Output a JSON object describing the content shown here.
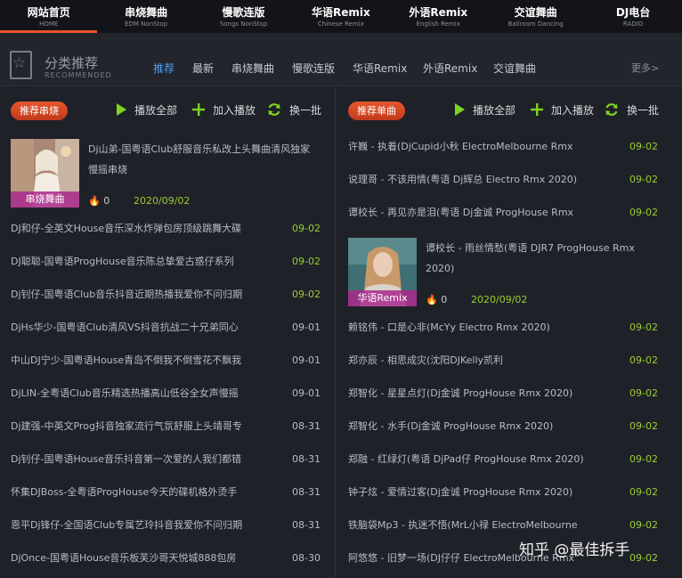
{
  "top_nav": [
    {
      "zh": "网站首页",
      "en": "HOME"
    },
    {
      "zh": "串烧舞曲",
      "en": "EDM NonStop"
    },
    {
      "zh": "慢歌连版",
      "en": "Songs NonStop"
    },
    {
      "zh": "华语Remix",
      "en": "Chinese Remix"
    },
    {
      "zh": "外语Remix",
      "en": "English Remix"
    },
    {
      "zh": "交谊舞曲",
      "en": "Ballroom Dancing"
    },
    {
      "zh": "DJ电台",
      "en": "RADIO"
    }
  ],
  "section": {
    "title": "分类推荐",
    "subtitle": "RECOMMENDED",
    "more": "更多>"
  },
  "tabs": [
    "推荐",
    "最新",
    "串烧舞曲",
    "慢歌连版",
    "华语Remix",
    "外语Remix",
    "交谊舞曲"
  ],
  "left": {
    "badge": "推荐串烧",
    "play_all": "播放全部",
    "add_play": "加入播放",
    "refresh": "换一批",
    "feature": {
      "cover_label": "串烧舞曲",
      "title": "Dj山弟-国粤语Club舒服音乐私改上头舞曲清风独家慢摇串烧",
      "plays": "0",
      "date": "2020/09/02"
    },
    "rows": [
      {
        "title": "DJ和仔-全英文House音乐深水炸弹包房顶级跳舞大碟",
        "date": "09-02",
        "recent": true
      },
      {
        "title": "DJ聪聪-国粤语ProgHouse音乐陈总挚爱古惑仔系列",
        "date": "09-02",
        "recent": true
      },
      {
        "title": "Dj钊仔-国粤语Club音乐抖音近期热播我爱你不问归期",
        "date": "09-02",
        "recent": true
      },
      {
        "title": "DjHs华少-国粤语Club清风VS抖音抗战二十兄弟同心",
        "date": "09-01",
        "recent": false
      },
      {
        "title": "中山DJ宁少-国粤语House青岛不倒我不倒雪花不飘我",
        "date": "09-01",
        "recent": false
      },
      {
        "title": "DjLIN-全粤语Club音乐精选热播高山低谷全女声慢摇",
        "date": "09-01",
        "recent": false
      },
      {
        "title": "Dj建强-中英文Prog抖音独家流行气氛舒服上头靖哥专",
        "date": "08-31",
        "recent": false
      },
      {
        "title": "Dj钊仔-国粤语House音乐抖音第一次爱的人我们都错",
        "date": "08-31",
        "recent": false
      },
      {
        "title": "怀集DJBoss-全粤语ProgHouse今天的碟机格外烫手",
        "date": "08-31",
        "recent": false
      },
      {
        "title": "恩平Dj锋仔-全国语Club专属艺玲抖音我爱你不问归期",
        "date": "08-31",
        "recent": false
      },
      {
        "title": "DjOnce-国粤语House音乐板芙沙哥天悦城888包房",
        "date": "08-30",
        "recent": false
      }
    ]
  },
  "right": {
    "badge": "推荐单曲",
    "play_all": "播放全部",
    "add_play": "加入播放",
    "refresh": "换一批",
    "rows_top": [
      {
        "title": "许巍 - 执着(DjCupid小秋 ElectroMelbourne Rmx",
        "date": "09-02"
      },
      {
        "title": "说理哥 - 不该用情(粤语 Dj辉总 Electro Rmx 2020)",
        "date": "09-02"
      },
      {
        "title": "谭校长 - 再见亦是泪(粤语 Dj金诚 ProgHouse Rmx",
        "date": "09-02"
      }
    ],
    "feature": {
      "cover_label": "华语Remix",
      "title": "谭校长 - 雨丝情愁(粤语 DJR7 ProgHouse Rmx 2020)",
      "plays": "0",
      "date": "2020/09/02"
    },
    "rows": [
      {
        "title": "赖铭伟 - 口是心非(McYy Electro Rmx 2020)",
        "date": "09-02"
      },
      {
        "title": "郑亦辰 - 相思成灾(沈阳DJKelly凯利",
        "date": "09-02"
      },
      {
        "title": "郑智化 - 星星点灯(Dj金诚 ProgHouse Rmx 2020)",
        "date": "09-02"
      },
      {
        "title": "郑智化 - 水手(Dj金诚 ProgHouse Rmx 2020)",
        "date": "09-02"
      },
      {
        "title": "郑融 - 红绿灯(粤语 DjPad仔 ProgHouse Rmx 2020)",
        "date": "09-02"
      },
      {
        "title": "钟子炫 - 爱情过客(Dj金诚 ProgHouse Rmx 2020)",
        "date": "09-02"
      },
      {
        "title": "铁脑袋Mp3 - 执迷不悟(MrL小禄 ElectroMelbourne",
        "date": "09-02"
      },
      {
        "title": "阿悠悠 - 旧梦一场(DJ仔仔 ElectroMelbourne Rmx",
        "date": "09-02"
      }
    ]
  },
  "watermark": "知乎 @最佳拆手",
  "colors": {
    "accent": "#e8542a",
    "tab_active": "#4ea0f5",
    "date_green": "#9acd32",
    "icon_green": "#7ed321"
  }
}
